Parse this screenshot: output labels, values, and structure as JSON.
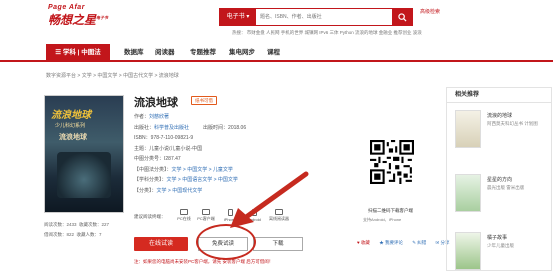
{
  "header": {
    "logo_en": "Page Afar",
    "logo_cn": "畅想之星",
    "logo_sup": "电子书",
    "search": {
      "category": "电子书",
      "placeholder": "题名、ISBN、作者、出版社",
      "hot_label": "热门搜索：",
      "hot_terms": "热搜：  市财金盘  人民网  手机的世界  城镇网  IPv6  三体  Python  流浪的地球 金融业  推荐创业  波浪"
    },
    "quick_link": "高级检索"
  },
  "nav": {
    "category_label": "学科 | 中图法",
    "items": [
      "数据库",
      "阅读器",
      "专题推荐",
      "集电网步",
      "课程"
    ]
  },
  "breadcrumb": "数字资源平台 > 文学 > 中国文学 > 中国古代文学 > 流浪地球",
  "book": {
    "cover_title": "流浪地球",
    "cover_subtitle": "少儿科幻系列",
    "cover_subtitle2": "流浪地球",
    "title": "流浪地球",
    "badge": "纸书可借",
    "meta": [
      {
        "label": "作者：",
        "value": "刘慈欣著"
      },
      {
        "label": "出版社：",
        "value": "科学普及出版社",
        "extra_label": "出版时间：",
        "extra_value": "2018.06"
      },
      {
        "label": "ISBN：",
        "value": "978-7-110-09821-9"
      },
      {
        "label": "主题：",
        "value": "儿童小说/儿童小说-中国"
      },
      {
        "label": "中图分类号：",
        "value": "I287.47"
      },
      {
        "label": "【中图法分类】：",
        "value": "文学 > 中国文学 > 儿童文学"
      },
      {
        "label": "【学科分类】：",
        "value": "文学 > 中国语言文学 > 中国文学"
      },
      {
        "label": "【分类】：",
        "value": "文学 > 中国现代文学"
      }
    ],
    "stats": {
      "read_label": "阅读次数：",
      "read_count": "2433",
      "collect_label": "收藏次数：",
      "collect_count": "227",
      "borrow_label": "借阅次数：",
      "borrow_count": "822",
      "fav_label": "收藏人数：",
      "fav_count": "7"
    }
  },
  "read_modes": {
    "label": "建议阅读终端：",
    "modes": [
      "PC在线",
      "PC客户端",
      "iPhone",
      "Android",
      "离线阅读器"
    ]
  },
  "buttons": {
    "read_online": "在线试读",
    "free_read": "免费试读",
    "download": "下载"
  },
  "notice": "注：如果您的电脑尚未安装PC客户端，请先 安装客户端 后方可借阅！",
  "qr": {
    "label": "扫描二维码下载客户端",
    "sub": "支持Android、iPhone"
  },
  "actions": [
    "♥ 收藏",
    "★ 我要评论",
    "✎ 纠错",
    "✉ 分享"
  ],
  "sidebar": {
    "heading": "相关推荐",
    "items": [
      {
        "name": "流浪的地球",
        "sub": "阿西莫夫科幻丛书 计划图"
      },
      {
        "name": "星星的方向",
        "sub": "晨光出版 雷米出版"
      },
      {
        "name": "橘子故事",
        "sub": "少年儿童出版"
      }
    ]
  },
  "colors": {
    "brand": "#c2161b",
    "accent_orange": "#e25a1c",
    "link_blue": "#2b6bb3"
  }
}
